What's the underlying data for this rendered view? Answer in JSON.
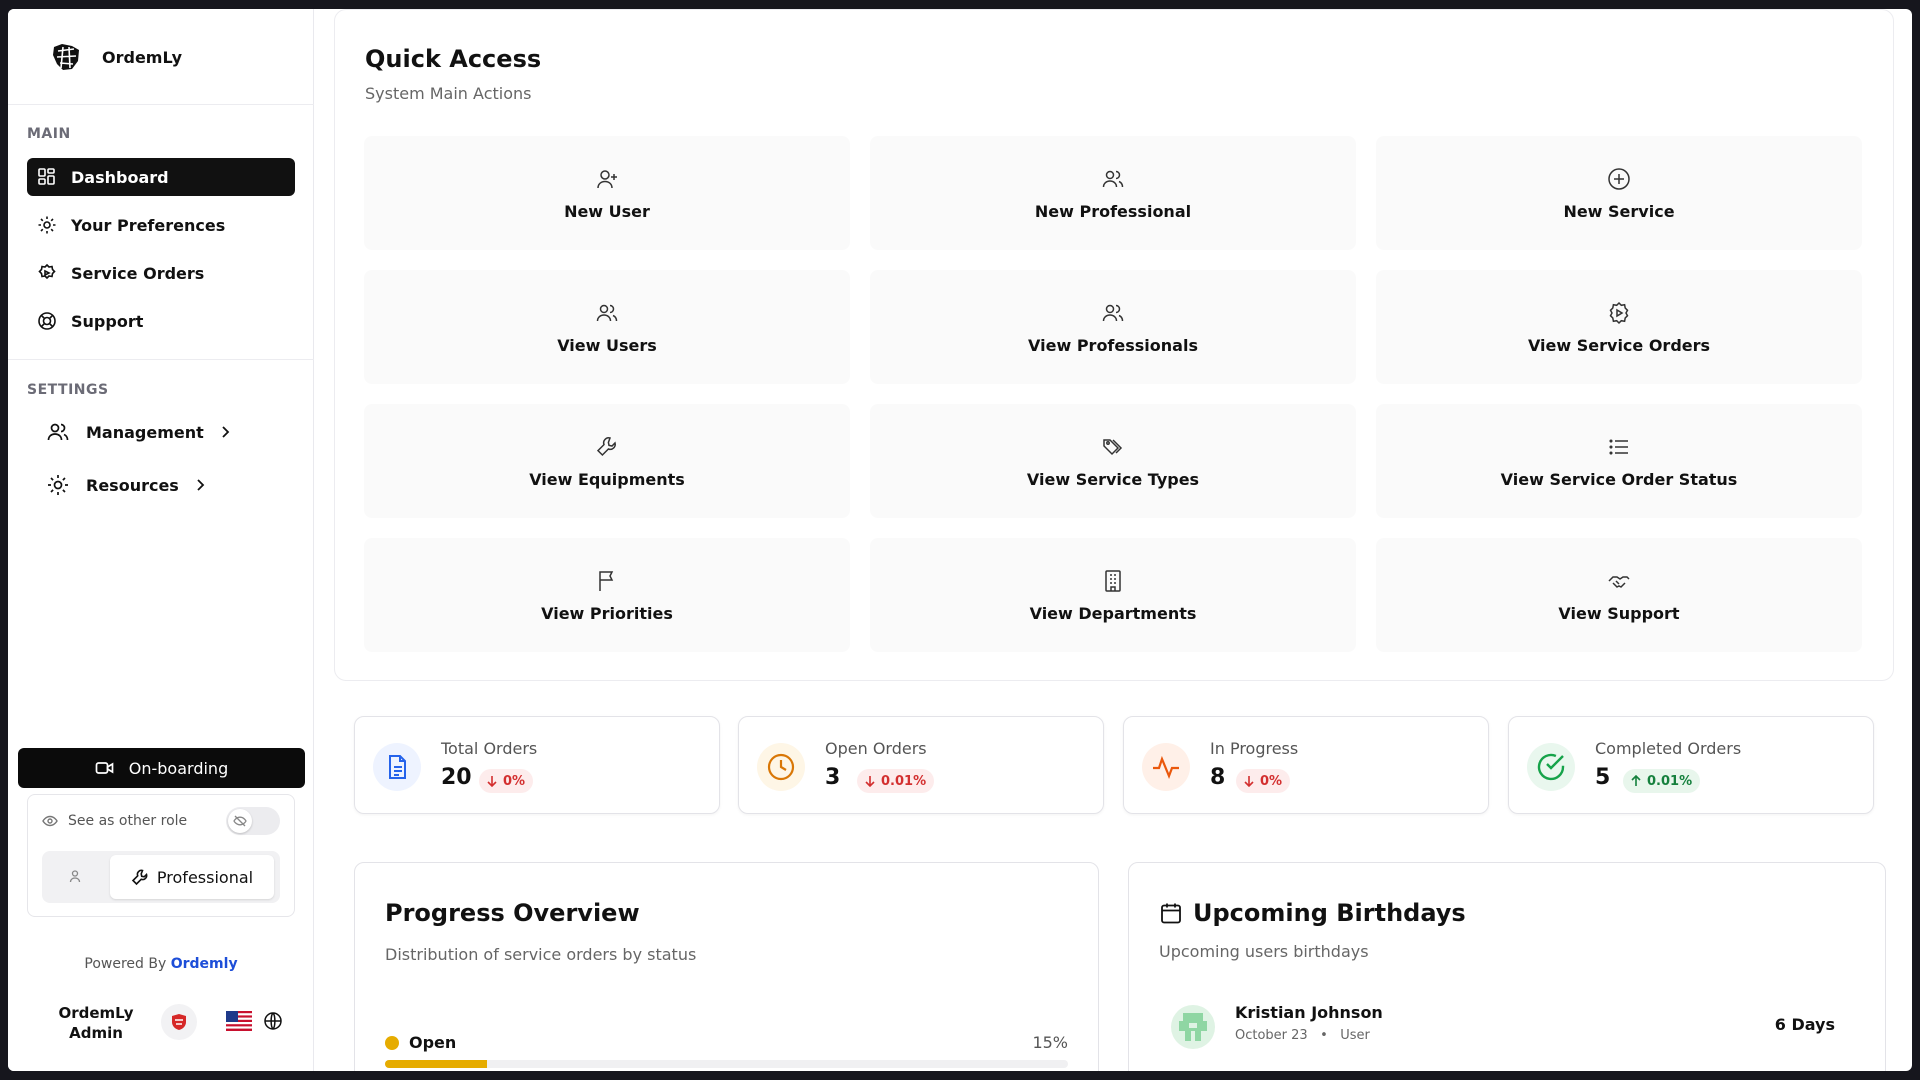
{
  "brand": {
    "name": "OrdemLy"
  },
  "sidebar": {
    "main_label": "MAIN",
    "main_items": [
      {
        "label": "Dashboard",
        "icon": "dashboard-grid-icon",
        "active": true
      },
      {
        "label": "Your Preferences",
        "icon": "gear-icon"
      },
      {
        "label": "Service Orders",
        "icon": "cog-badge-icon"
      },
      {
        "label": "Support",
        "icon": "lifebuoy-icon"
      }
    ],
    "settings_label": "SETTINGS",
    "settings_items": [
      {
        "label": "Management",
        "icon": "users-icon"
      },
      {
        "label": "Resources",
        "icon": "gear-icon"
      }
    ],
    "onboarding_label": "On-boarding",
    "role_toggle_label": "See as other role",
    "role_selected": "Professional",
    "powered_prefix": "Powered By",
    "powered_link": "Ordemly",
    "user_name_line1": "OrdemLy",
    "user_name_line2": "Admin"
  },
  "quick_access": {
    "title": "Quick Access",
    "subtitle": "System Main Actions",
    "tiles": [
      {
        "label": "New User",
        "icon": "user-plus-icon"
      },
      {
        "label": "New Professional",
        "icon": "users-icon"
      },
      {
        "label": "New Service",
        "icon": "plus-circle-icon"
      },
      {
        "label": "View Users",
        "icon": "users-icon"
      },
      {
        "label": "View Professionals",
        "icon": "users-icon"
      },
      {
        "label": "View Service Orders",
        "icon": "cog-play-icon"
      },
      {
        "label": "View Equipments",
        "icon": "wrench-icon"
      },
      {
        "label": "View Service Types",
        "icon": "tags-icon"
      },
      {
        "label": "View Service Order Status",
        "icon": "list-icon"
      },
      {
        "label": "View Priorities",
        "icon": "flag-icon"
      },
      {
        "label": "View Departments",
        "icon": "building-icon"
      },
      {
        "label": "View Support",
        "icon": "handshake-icon"
      }
    ]
  },
  "stats": [
    {
      "label": "Total Orders",
      "value": "20",
      "change": "0%",
      "direction": "down",
      "icon": "document-icon",
      "color": "#2563eb",
      "bg": "#eef3ff"
    },
    {
      "label": "Open Orders",
      "value": "3",
      "change": "0.01%",
      "direction": "down",
      "icon": "clock-icon",
      "color": "#d97706",
      "bg": "#fef6e6"
    },
    {
      "label": "In Progress",
      "value": "8",
      "change": "0%",
      "direction": "down",
      "icon": "activity-icon",
      "color": "#ea580c",
      "bg": "#fff0e8"
    },
    {
      "label": "Completed Orders",
      "value": "5",
      "change": "0.01%",
      "direction": "up",
      "icon": "check-circle-icon",
      "color": "#16a34a",
      "bg": "#e9f7ee"
    }
  ],
  "progress": {
    "title": "Progress Overview",
    "subtitle": "Distribution of service orders by status",
    "rows": [
      {
        "label": "Open",
        "percent_text": "15%",
        "fraction": 0.15,
        "color": "#e6ac00"
      }
    ]
  },
  "birthdays": {
    "title": "Upcoming Birthdays",
    "subtitle": "Upcoming users birthdays",
    "items": [
      {
        "name": "Kristian Johnson",
        "date": "October 23",
        "role": "User",
        "days": "6 Days"
      }
    ]
  }
}
